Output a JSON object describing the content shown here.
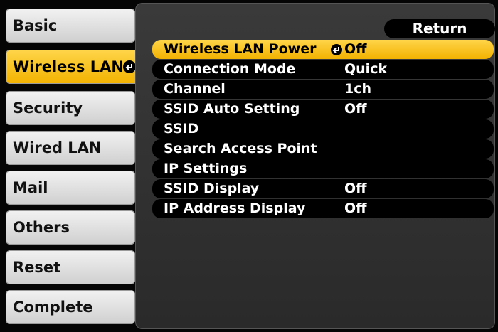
{
  "sidebar": {
    "items": [
      {
        "label": "Basic"
      },
      {
        "label": "Wireless LAN"
      },
      {
        "label": "Security"
      },
      {
        "label": "Wired LAN"
      },
      {
        "label": "Mail"
      },
      {
        "label": "Others"
      },
      {
        "label": "Reset"
      },
      {
        "label": "Complete"
      }
    ],
    "selected_index": 1
  },
  "panel": {
    "return_label": "Return",
    "rows": [
      {
        "label": "Wireless LAN Power",
        "value": "Off"
      },
      {
        "label": "Connection Mode",
        "value": "Quick"
      },
      {
        "label": "Channel",
        "value": "1ch"
      },
      {
        "label": "SSID Auto Setting",
        "value": "Off"
      },
      {
        "label": "SSID",
        "value": ""
      },
      {
        "label": "Search Access Point",
        "value": ""
      },
      {
        "label": "IP Settings",
        "value": ""
      },
      {
        "label": "SSID Display",
        "value": "Off"
      },
      {
        "label": "IP Address Display",
        "value": "Off"
      }
    ],
    "selected_index": 0
  },
  "colors": {
    "highlight": "#f2b200",
    "panel_bg": "#2f2f2f",
    "row_bg": "#000000"
  }
}
